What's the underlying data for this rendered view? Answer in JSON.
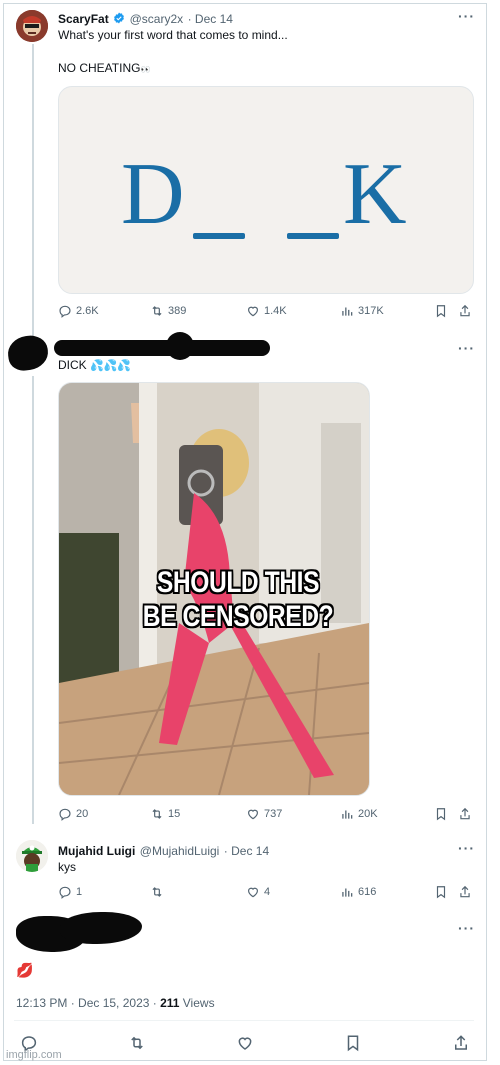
{
  "tweet1": {
    "name": "ScaryFat",
    "handle": "@scary2x",
    "date": "· Dec 14",
    "text": "What's your first word that comes to mind...",
    "subtext": "NO CHEATING",
    "subtext_emoji": "👀",
    "image_letters": [
      "D_",
      "_K"
    ],
    "stats": {
      "replies": "2.6K",
      "retweets": "389",
      "likes": "1.4K",
      "views": "317K"
    }
  },
  "tweet2": {
    "text": "DICK",
    "emoji": "💦💦💦",
    "meme_text_line1": "SHOULD THIS",
    "meme_text_line2": "BE CENSORED?",
    "stats": {
      "replies": "20",
      "retweets": "15",
      "likes": "737",
      "views": "20K"
    }
  },
  "tweet3": {
    "name": "Mujahid Luigi",
    "handle": "@MujahidLuigi",
    "date": "· Dec 14",
    "text": "kys",
    "stats": {
      "replies": "1",
      "retweets": "",
      "likes": "4",
      "views": "616"
    }
  },
  "tweet4": {
    "emoji": "💋",
    "time": "12:13 PM · Dec 15, 2023 · ",
    "views_count": "211",
    "views_label": " Views"
  },
  "more_glyph": "···",
  "watermark": "imgflip.com",
  "colors": {
    "accent": "#1d9bf0",
    "muted": "#536471",
    "dk_blue": "#1a6ea6"
  }
}
